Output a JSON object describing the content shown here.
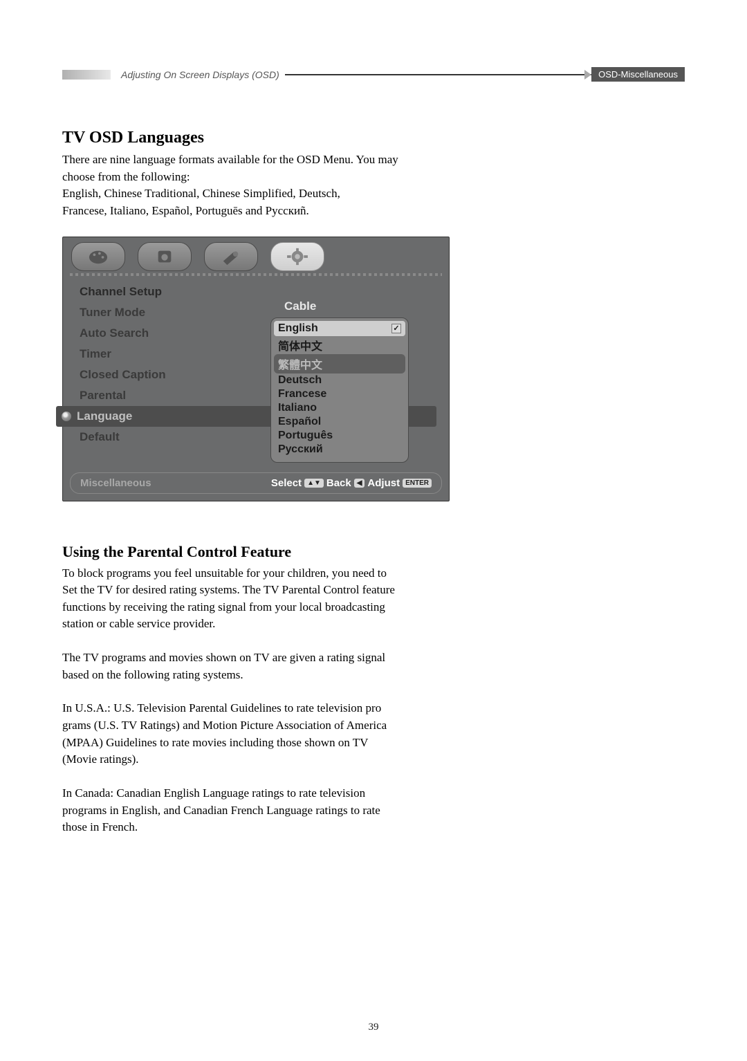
{
  "header": {
    "left_text": "Adjusting On Screen Displays (OSD)",
    "right_text": "OSD-Miscellaneous"
  },
  "section1": {
    "title": "TV OSD Languages",
    "para1_l1": "There are nine language formats available for the OSD Menu. You may",
    "para1_l2": "choose from the following:",
    "para1_l3": "English, Chinese Traditional, Chinese Simplified, Deutsch,",
    "para1_l4": "Francese, Italiano, Español, Portuguēs and Русскиñ."
  },
  "osd": {
    "menu_items": {
      "channel_setup": "Channel Setup",
      "tuner_mode": "Tuner Mode",
      "auto_search": "Auto Search",
      "timer": "Timer",
      "closed_caption": "Closed Caption",
      "parental": "Parental",
      "language": "Language",
      "default": "Default"
    },
    "tuner_value": "Cable",
    "languages": {
      "english": "English",
      "zh_simp": "简体中文",
      "zh_trad": "繁體中文",
      "deutsch": "Deutsch",
      "francese": "Francese",
      "italiano": "Italiano",
      "espanol": "Español",
      "portugues": "Português",
      "russian": "Русский"
    },
    "footer": {
      "tab_label": "Miscellaneous",
      "select": "Select",
      "back": "Back",
      "adjust": "Adjust",
      "key_nav": "▲▼",
      "key_back": "◀",
      "key_enter": "ENTER"
    }
  },
  "section2": {
    "title": "Using the Parental Control Feature",
    "p1_l1": "To block programs you feel unsuitable for your children, you need to",
    "p1_l2": "Set the TV for desired rating systems. The TV Parental Control feature",
    "p1_l3": "functions by receiving the rating signal from your local broadcasting",
    "p1_l4": "station or cable service provider.",
    "p2_l1": "The TV programs and movies shown on TV are given a rating signal",
    "p2_l2": "based on the following rating systems.",
    "p3_l1": "In U.S.A.: U.S. Television Parental Guidelines to rate television pro",
    "p3_l2": "grams (U.S. TV Ratings) and Motion Picture Association of America",
    "p3_l3": "(MPAA) Guidelines to rate movies including those shown on TV",
    "p3_l4": "(Movie ratings).",
    "p4_l1": "In Canada: Canadian English Language ratings to rate television",
    "p4_l2": "programs in English, and Canadian French Language ratings to rate",
    "p4_l3": "those in French."
  },
  "page_number": "39"
}
